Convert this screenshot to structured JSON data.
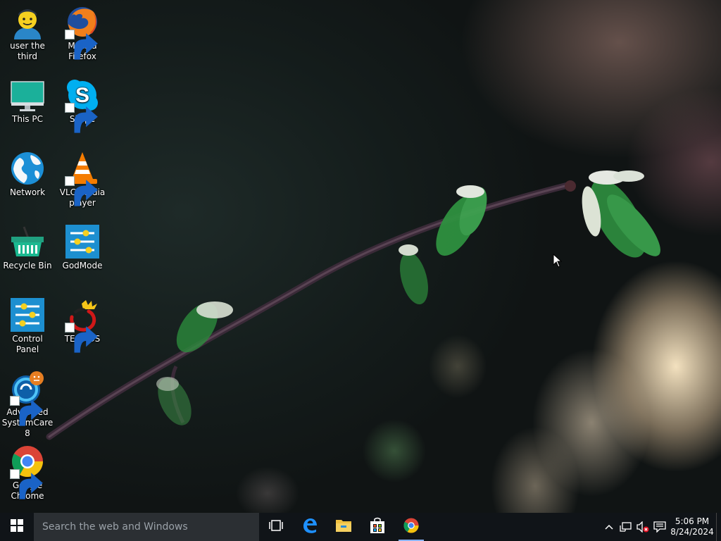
{
  "desktop": {
    "icons": [
      {
        "label": "user the third",
        "icon": "user-icon",
        "shortcut": false
      },
      {
        "label": "Mozilla Firefox",
        "icon": "firefox-icon",
        "shortcut": true
      },
      {
        "label": "This PC",
        "icon": "monitor-icon",
        "shortcut": false
      },
      {
        "label": "Skype",
        "icon": "skype-icon",
        "shortcut": true
      },
      {
        "label": "Network",
        "icon": "globe-icon",
        "shortcut": false
      },
      {
        "label": "VLC media player",
        "icon": "vlc-cone-icon",
        "shortcut": true
      },
      {
        "label": "Recycle Bin",
        "icon": "recycle-bin-icon",
        "shortcut": false
      },
      {
        "label": "GodMode",
        "icon": "settings-sliders-icon",
        "shortcut": false
      },
      {
        "label": "Control Panel",
        "icon": "settings-sliders-icon",
        "shortcut": false
      },
      {
        "label": "TEAMOS",
        "icon": "teamos-crown-icon",
        "shortcut": true
      },
      {
        "label": "Advanced SystemCare 8",
        "icon": "systemcare-icon",
        "shortcut": true
      },
      {
        "label": "Google Chrome",
        "icon": "chrome-icon",
        "shortcut": true
      }
    ]
  },
  "taskbar": {
    "search_placeholder": "Search the web and Windows",
    "pinned": [
      {
        "name": "task-view",
        "icon": "task-view-icon"
      },
      {
        "name": "edge",
        "icon": "edge-icon"
      },
      {
        "name": "file-explorer",
        "icon": "folder-icon"
      },
      {
        "name": "store",
        "icon": "store-bag-icon"
      },
      {
        "name": "chrome",
        "icon": "chrome-icon",
        "active": true
      }
    ],
    "tray": {
      "icons": [
        "chevron-up-icon",
        "network-icon",
        "volume-muted-icon",
        "notification-icon"
      ],
      "time": "5:06 PM",
      "date": "8/24/2024"
    }
  },
  "colors": {
    "taskbar_bg": "#101418",
    "search_bg": "#2b2f33",
    "accent": "#8ab4f8"
  }
}
